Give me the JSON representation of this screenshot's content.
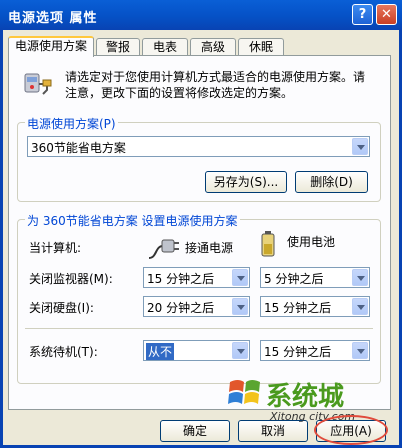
{
  "window": {
    "title": "电源选项 属性",
    "help_glyph": "?",
    "close_glyph": "✕"
  },
  "tabs": [
    {
      "label": "电源使用方案",
      "active": true
    },
    {
      "label": "警报",
      "active": false
    },
    {
      "label": "电表",
      "active": false
    },
    {
      "label": "高级",
      "active": false
    },
    {
      "label": "休眠",
      "active": false
    }
  ],
  "intro": {
    "text_line1": "请选定对于您使用计算机方式最适合的电源使用方案。请",
    "text_line2": "注意，更改下面的设置将修改选定的方案。",
    "icon": "power-options-icon"
  },
  "scheme_group": {
    "label": "电源使用方案(P)",
    "selected": "360节能省电方案",
    "save_as_label": "另存为(S)...",
    "delete_label": "删除(D)"
  },
  "settings_group": {
    "label": "为 360节能省电方案 设置电源使用方案",
    "current_computer_label": "当计算机:",
    "plugged_in_label": "接通电源",
    "battery_label": "使用电池",
    "plugged_in_icon": "power-plug-icon",
    "battery_icon": "battery-icon",
    "rows": [
      {
        "label": "关闭监视器(M):",
        "plugged": "15 分钟之后",
        "battery": "5 分钟之后",
        "plugged_selected": false
      },
      {
        "label": "关闭硬盘(I):",
        "plugged": "20 分钟之后",
        "battery": "15 分钟之后",
        "plugged_selected": false
      },
      {
        "label": "系统待机(T):",
        "plugged": "从不",
        "battery": "15 分钟之后",
        "plugged_selected": true
      }
    ]
  },
  "footer": {
    "ok_label": "确定",
    "cancel_label": "取消",
    "apply_label": "应用(A)"
  },
  "watermark": {
    "text": "系统城",
    "sub": "Xitong city.com"
  },
  "colors": {
    "titlebar": "#0551c6",
    "group_label": "#0046d5",
    "selection": "#316ac5",
    "dialog_bg": "#ece9d8",
    "highlight_circle": "#e04b3c"
  }
}
